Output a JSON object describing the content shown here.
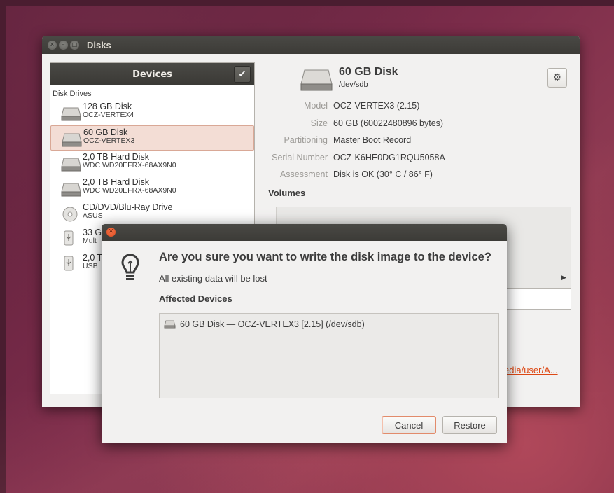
{
  "window": {
    "title": "Disks"
  },
  "sidebar": {
    "header": "Devices",
    "section_label": "Disk Drives",
    "drives": [
      {
        "name": "128 GB Disk",
        "model": "OCZ-VERTEX4",
        "icon": "hard-disk-icon",
        "selected": false
      },
      {
        "name": "60 GB Disk",
        "model": "OCZ-VERTEX3",
        "icon": "hard-disk-icon",
        "selected": true
      },
      {
        "name": "2,0 TB Hard Disk",
        "model": "WDC WD20EFRX-68AX9N0",
        "icon": "hard-disk-icon",
        "selected": false
      },
      {
        "name": "2,0 TB Hard Disk",
        "model": "WDC WD20EFRX-68AX9N0",
        "icon": "hard-disk-icon",
        "selected": false
      },
      {
        "name": "CD/DVD/Blu-Ray Drive",
        "model": "ASUS",
        "icon": "optical-drive-icon",
        "selected": false
      },
      {
        "name": "33 G",
        "model": "Mult",
        "icon": "usb-drive-icon",
        "selected": false
      },
      {
        "name": "2,0 T",
        "model": "USB",
        "icon": "usb-drive-icon",
        "selected": false
      }
    ]
  },
  "disk": {
    "title": "60 GB Disk",
    "device": "/dev/sdb",
    "properties": [
      {
        "key": "Model",
        "value": "OCZ-VERTEX3 (2.15)"
      },
      {
        "key": "Size",
        "value": "60 GB (60022480896 bytes)"
      },
      {
        "key": "Partitioning",
        "value": "Master Boot Record"
      },
      {
        "key": "Serial Number",
        "value": "OCZ-K6HE0DG1RQU5058A"
      },
      {
        "key": "Assessment",
        "value": "Disk is OK (30° C / 86° F)"
      }
    ],
    "volumes_label": "Volumes",
    "mount_link": "edia/user/A..."
  },
  "dialog": {
    "heading": "Are you sure you want to write the disk image to the device?",
    "subtext": "All existing data will be lost",
    "affected_label": "Affected Devices",
    "device_entry": "60 GB Disk — OCZ-VERTEX3 [2.15] (/dev/sdb)",
    "cancel_label": "Cancel",
    "restore_label": "Restore"
  },
  "colors": {
    "accent": "#dd4814",
    "titlebar": "#3c3b37",
    "selected_row": "#f3ddd5"
  }
}
